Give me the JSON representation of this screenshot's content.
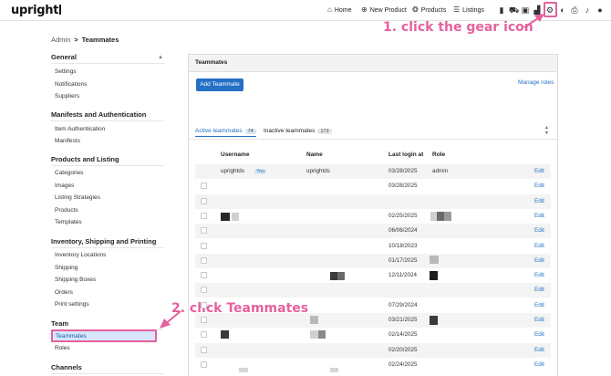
{
  "app": {
    "logo": "upright"
  },
  "topnav": {
    "items": [
      {
        "icon": "home-icon",
        "label": "Home"
      },
      {
        "icon": "plus-circle-icon",
        "label": "New Product"
      },
      {
        "icon": "products-icon",
        "label": "Products"
      },
      {
        "icon": "list-icon",
        "label": "Listings"
      }
    ]
  },
  "breadcrumb": {
    "parent": "Admin",
    "separator": ">",
    "current": "Teammates"
  },
  "sidebar": {
    "sections": [
      {
        "title": "General",
        "items": [
          "Settings",
          "Notifications",
          "Suppliers"
        ]
      },
      {
        "title": "Manifests and Authentication",
        "items": [
          "Item Authentication",
          "Manifests"
        ]
      },
      {
        "title": "Products and Listing",
        "items": [
          "Categories",
          "Images",
          "Listing Strategies",
          "Products",
          "Templates"
        ]
      },
      {
        "title": "Inventory, Shipping and Printing",
        "items": [
          "Inventory Locations",
          "Shipping",
          "Shipping Boxes",
          "Orders",
          "Print settings"
        ]
      },
      {
        "title": "Team",
        "items": [
          "Teammates",
          "Roles"
        ]
      },
      {
        "title": "Channels",
        "items": []
      }
    ],
    "active_item": "Teammates"
  },
  "annotations": {
    "step1": "1. click the gear icon",
    "step2": "2. click Teammates",
    "color": "#e6609f"
  },
  "panel": {
    "title": "Teammates",
    "add_button": "Add Teammate",
    "manage_roles": "Manage roles",
    "tabs": [
      {
        "label": "Active teammates",
        "count": "74"
      },
      {
        "label": "Inactive teammates",
        "count": "173"
      }
    ],
    "columns": [
      "Username",
      "Name",
      "Last login at",
      "Role"
    ],
    "edit_label": "Edit",
    "rows": [
      {
        "username": "uprightds",
        "badge": "You",
        "name": "uprightds",
        "last_login": "03/28/2025",
        "role": "admin"
      },
      {
        "username": "",
        "badge": "",
        "name": "",
        "last_login": "03/28/2025",
        "role": ""
      },
      {
        "username": "",
        "badge": "",
        "name": "",
        "last_login": "",
        "role": ""
      },
      {
        "username": "",
        "badge": "",
        "name": "",
        "last_login": "02/25/2025",
        "role": ""
      },
      {
        "username": "",
        "badge": "",
        "name": "",
        "last_login": "06/06/2024",
        "role": ""
      },
      {
        "username": "",
        "badge": "",
        "name": "",
        "last_login": "10/18/2023",
        "role": ""
      },
      {
        "username": "",
        "badge": "",
        "name": "",
        "last_login": "01/17/2025",
        "role": ""
      },
      {
        "username": "",
        "badge": "",
        "name": "",
        "last_login": "12/11/2024",
        "role": ""
      },
      {
        "username": "",
        "badge": "",
        "name": "",
        "last_login": "",
        "role": ""
      },
      {
        "username": "",
        "badge": "",
        "name": "",
        "last_login": "07/29/2024",
        "role": ""
      },
      {
        "username": "",
        "badge": "",
        "name": "",
        "last_login": "03/21/2025",
        "role": ""
      },
      {
        "username": "",
        "badge": "",
        "name": "",
        "last_login": "02/14/2025",
        "role": ""
      },
      {
        "username": "",
        "badge": "",
        "name": "",
        "last_login": "02/20/2025",
        "role": ""
      },
      {
        "username": "",
        "badge": "",
        "name": "",
        "last_login": "02/24/2025",
        "role": ""
      }
    ]
  },
  "colors": {
    "accent": "#2470c6",
    "active_bg": "#d7e6fb",
    "highlight": "#e6609f"
  }
}
